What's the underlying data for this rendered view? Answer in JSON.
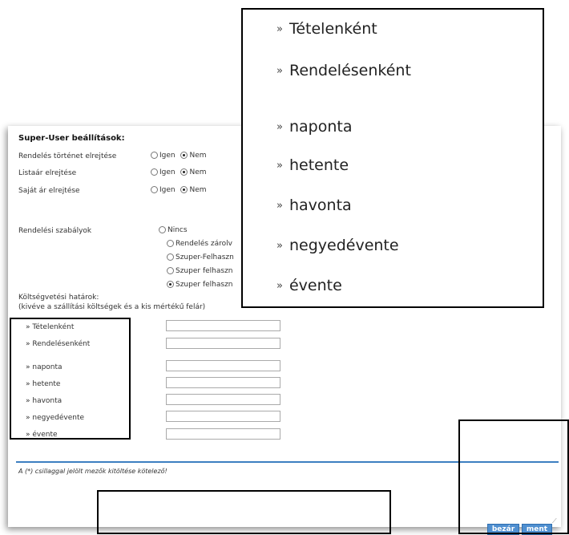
{
  "super_user": {
    "title": "Super-User beállítások:",
    "rows": [
      {
        "label": "Rendelés történet elrejtése",
        "yes": "Igen",
        "no": "Nem",
        "selected": "no"
      },
      {
        "label": "Listaár elrejtése",
        "yes": "Igen",
        "no": "Nem",
        "selected": "no"
      },
      {
        "label": "Saját ár elrejtése",
        "yes": "Igen",
        "no": "Nem",
        "selected": "no"
      }
    ]
  },
  "order_rules": {
    "label": "Rendelési szabályok",
    "options": [
      {
        "label": "Nincs",
        "checked": false
      },
      {
        "label": "Rendelés zárolv",
        "checked": false
      },
      {
        "label": "Szuper-Felhaszn",
        "checked": false
      },
      {
        "label": "Szuper felhaszn",
        "checked": false
      },
      {
        "label": "Szuper felhaszn",
        "checked": true
      }
    ]
  },
  "budget": {
    "title_line1": "Költségvetési határok:",
    "title_line2": "(kivéve a szállítási költségek és a kis mértékű felár)",
    "items": [
      {
        "label": "» Tételenként",
        "value": ""
      },
      {
        "label": "» Rendelésenként",
        "value": ""
      },
      {
        "label": "» naponta",
        "value": ""
      },
      {
        "label": "» hetente",
        "value": ""
      },
      {
        "label": "» havonta",
        "value": ""
      },
      {
        "label": "» negyedévente",
        "value": ""
      },
      {
        "label": "» évente",
        "value": ""
      }
    ]
  },
  "footnote": "A (*) csillaggal jelölt mezők kitöltése kötelező!",
  "buttons": {
    "close": "bezár",
    "save": "ment"
  },
  "zoom": {
    "chevron": "»",
    "items": [
      "Tételenként",
      "Rendelésenként",
      "naponta",
      "hetente",
      "havonta",
      "negyedévente",
      "évente"
    ]
  },
  "colors": {
    "accent": "#3d7fc1",
    "button_bg": "#4f8fd0"
  }
}
